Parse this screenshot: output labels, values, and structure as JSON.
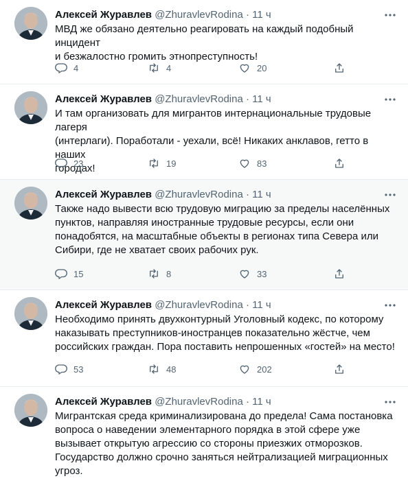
{
  "tweets": [
    {
      "name": "Алексей Журавлев",
      "handle": "@ZhuravlevRodina",
      "dot": "·",
      "time": "11 ч",
      "text": "МВД же обязано деятельно реагировать на каждый подобный инцидент\nи безжалостно громить этнопреступность!",
      "replies": "4",
      "retweets": "4",
      "likes": "20"
    },
    {
      "name": "Алексей Журавлев",
      "handle": "@ZhuravlevRodina",
      "dot": "·",
      "time": "11 ч",
      "text": "И там организовать для мигрантов интернациональные трудовые лагеря\n(интерлаги). Поработали - уехали, всё! Никаких анклавов, гетто в наших\nгородах!",
      "replies": "23",
      "retweets": "19",
      "likes": "83"
    },
    {
      "name": "Алексей Журавлев",
      "handle": "@ZhuravlevRodina",
      "dot": "·",
      "time": "11 ч",
      "text": "Также надо вывести всю трудовую миграцию за пределы населённых\nпунктов, направляя иностранные трудовые ресурсы, если они\nпонадобятся, на масштабные объекты в регионах типа Севера или\nСибири, где не хватает своих рабочих рук.",
      "replies": "15",
      "retweets": "8",
      "likes": "33"
    },
    {
      "name": "Алексей Журавлев",
      "handle": "@ZhuravlevRodina",
      "dot": "·",
      "time": "11 ч",
      "text": "Необходимо принять двухконтурный Уголовный кодекс, по которому\nнаказывать преступников-иностранцев показательно жёстче, чем\nроссийских граждан. Пора поставить непрошенных «гостей» на место!",
      "replies": "53",
      "retweets": "48",
      "likes": "202"
    },
    {
      "name": "Алексей Журавлев",
      "handle": "@ZhuravlevRodina",
      "dot": "·",
      "time": "11 ч",
      "text": "Мигрантская среда криминализирована до предела! Сама постановка\nвопроса о наведении элементарного порядка в этой сфере уже\nвызывает открытую агрессию со стороны приезжих отморозков.\nГосударство должно срочно заняться нейтрализацией миграционных\nугроз.",
      "replies": "",
      "retweets": "",
      "likes": ""
    }
  ],
  "icons": {
    "reply": "reply-icon",
    "retweet": "retweet-icon",
    "like": "heart-icon",
    "share": "share-icon",
    "more": "more-options-icon"
  },
  "colors": {
    "text": "#0f1419",
    "secondary": "#536471",
    "divider": "#e6ecf0",
    "highlight_bg": "#f7f9f9"
  }
}
